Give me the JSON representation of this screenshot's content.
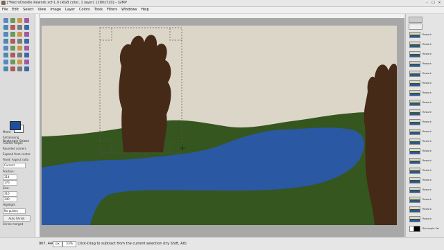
{
  "window": {
    "title": "[*NecroDoodle Rework.xcf-1.0 (RGB color, 1 layer) 1280x720] – GIMP",
    "controls": [
      "–",
      "□",
      "×"
    ]
  },
  "menu": [
    "File",
    "Edit",
    "Select",
    "View",
    "Image",
    "Layer",
    "Colors",
    "Tools",
    "Filters",
    "Windows",
    "Help"
  ],
  "toolbox": {
    "options_title": "Rectangle Select",
    "mode_label": "Mode:",
    "antialiasing": "Antialiasing",
    "feather": "Feather edges",
    "rounded": "Rounded corners",
    "expand": "Expand from center",
    "fixed": "Fixed: Aspect ratio",
    "fixed_value": "Current",
    "position_label": "Position:",
    "position_x": "314",
    "position_y": "176",
    "size_label": "Size:",
    "size_w": "316",
    "size_h": "340",
    "highlight": "Highlight",
    "guides": "No guides",
    "auto_shrink": "Auto Shrink",
    "shrink_merged": "Shrink merged",
    "colors": {
      "fg": "#1f4e9c",
      "bg": "#ffffff"
    },
    "tool_icons": [
      "rect-select-icon",
      "ellipse-select-icon",
      "free-select-icon",
      "fuzzy-select-icon",
      "scissors-icon",
      "foreground-select-icon",
      "paths-icon",
      "color-picker-icon",
      "zoom-icon",
      "measure-icon",
      "move-icon",
      "align-icon",
      "crop-icon",
      "rotate-icon",
      "scale-icon",
      "shear-icon",
      "perspective-icon",
      "flip-icon",
      "cage-icon",
      "warp-icon",
      "text-icon",
      "bucket-fill-icon",
      "blend-icon",
      "pencil-icon",
      "paintbrush-icon",
      "eraser-icon",
      "airbrush-icon",
      "ink-icon",
      "clone-icon",
      "heal-icon",
      "smudge-icon",
      "dodge-burn-icon"
    ]
  },
  "layers": {
    "top_icons": [
      "grid-icon",
      "image-icon"
    ],
    "items": [
      {
        "name": "Rework",
        "kind": "landscape"
      },
      {
        "name": "Rework",
        "kind": "landscape"
      },
      {
        "name": "Rework",
        "kind": "landscape"
      },
      {
        "name": "Rework",
        "kind": "landscape"
      },
      {
        "name": "Rework",
        "kind": "landscape"
      },
      {
        "name": "Rework",
        "kind": "landscape"
      },
      {
        "name": "Rework",
        "kind": "landscape"
      },
      {
        "name": "Rework",
        "kind": "landscape"
      },
      {
        "name": "Rework",
        "kind": "landscape"
      },
      {
        "name": "Rework",
        "kind": "landscape"
      },
      {
        "name": "Rework",
        "kind": "landscape"
      },
      {
        "name": "Rework",
        "kind": "landscape"
      },
      {
        "name": "Rework",
        "kind": "landscape"
      },
      {
        "name": "Rework",
        "kind": "landscape"
      },
      {
        "name": "Rework",
        "kind": "landscape"
      },
      {
        "name": "Rework",
        "kind": "landscape"
      },
      {
        "name": "Rework",
        "kind": "landscape"
      },
      {
        "name": "Rework",
        "kind": "landscape"
      },
      {
        "name": "Rework",
        "kind": "landscape"
      },
      {
        "name": "Rework",
        "kind": "landscape"
      },
      {
        "name": "Rectangle Sel",
        "kind": "mask"
      }
    ]
  },
  "status": {
    "coords": "907, 440",
    "unit": "px",
    "zoom": "33%",
    "message": "Click-Drag to subtract from the current selection (try Shift, Alt)"
  },
  "scene": {
    "sky_color": "#dcd6c8",
    "grass_color": "#35561f",
    "water_color": "#2a58a3",
    "trunk_color": "#452a18"
  }
}
